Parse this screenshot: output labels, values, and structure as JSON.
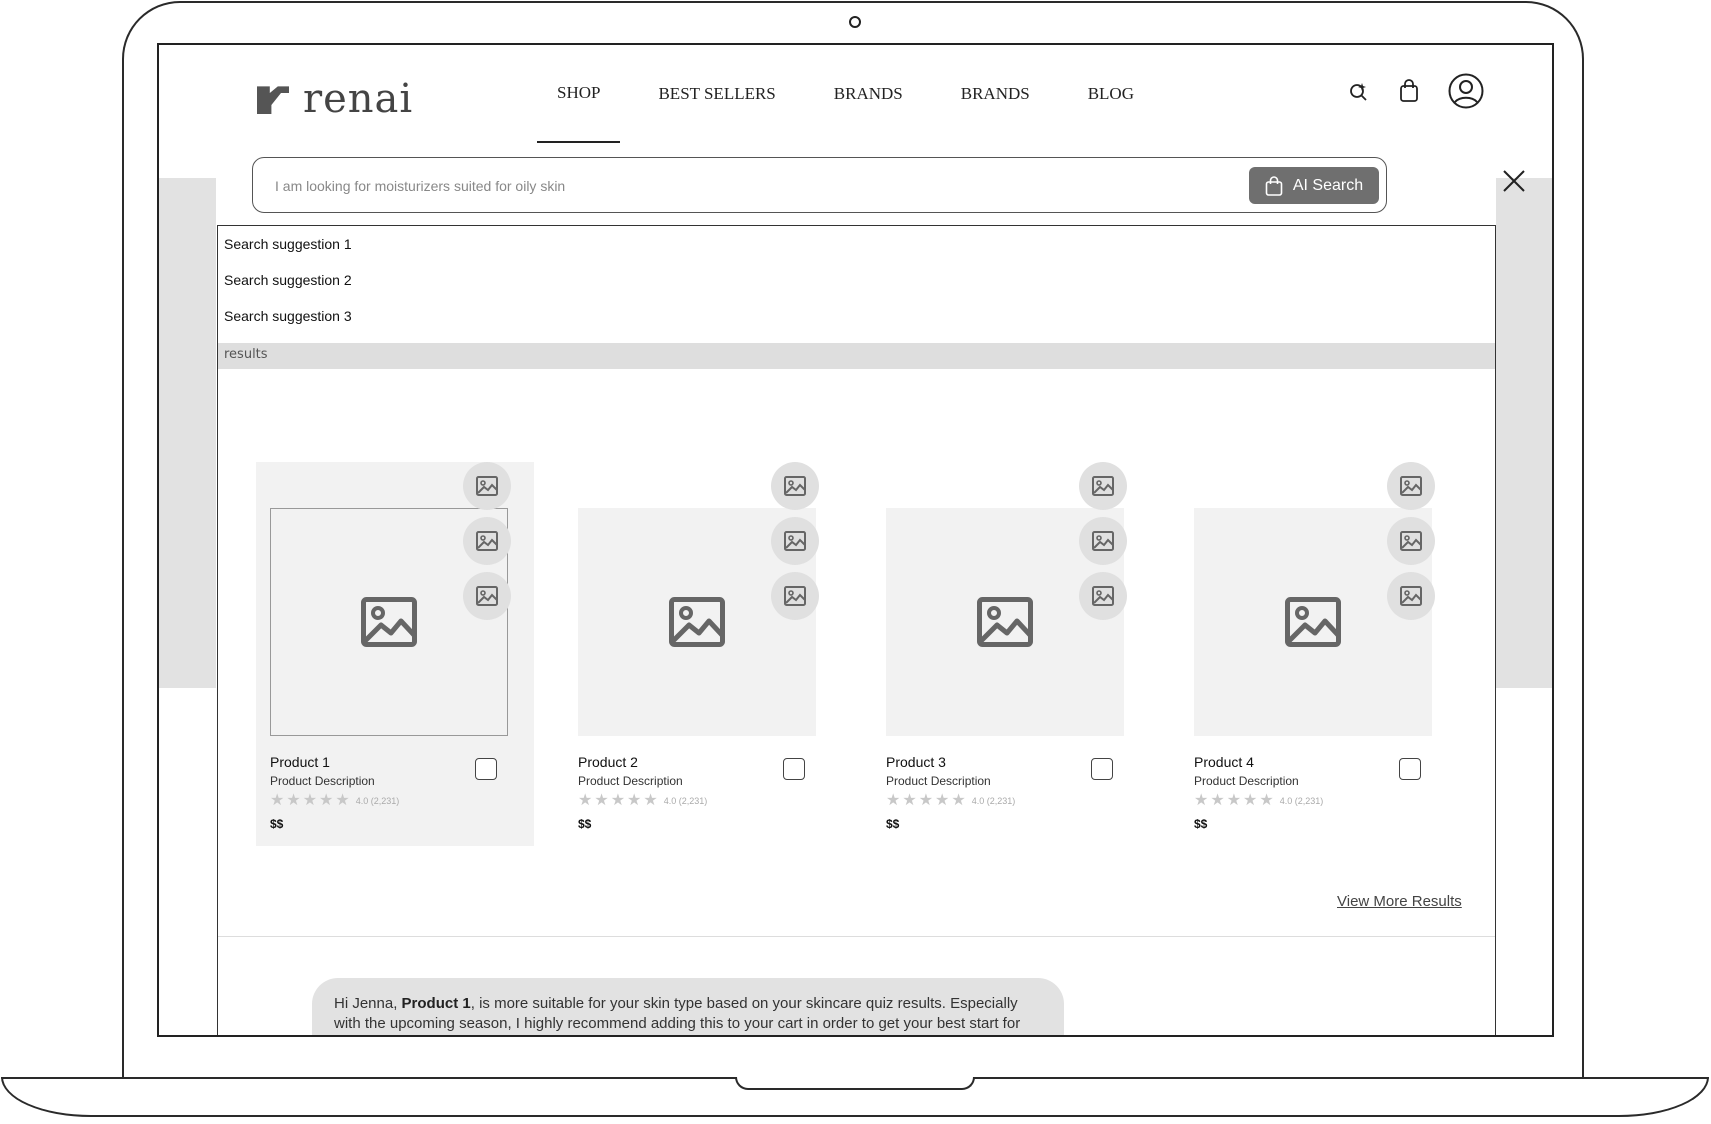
{
  "header": {
    "logo_text": "renai",
    "nav": [
      "SHOP",
      "BEST SELLERS",
      "BRANDS",
      "BRANDS",
      "BLOG"
    ],
    "active_nav": "SHOP",
    "icons": [
      "ai-search-icon",
      "bag-icon",
      "user-icon"
    ]
  },
  "search": {
    "placeholder": "I am looking for moisturizers suited for oily skin",
    "ai_button_label": "AI Search",
    "close_icon": "close-icon"
  },
  "suggestions": [
    "Search suggestion 1",
    "Search suggestion 2",
    "Search suggestion 3"
  ],
  "results_label": "results",
  "products": [
    {
      "name": "Product 1",
      "description": "Product Description",
      "rating": "4.0 (2,231)",
      "stars": 5,
      "price": "$$",
      "highlighted": true
    },
    {
      "name": "Product 2",
      "description": "Product Description",
      "rating": "4.0 (2,231)",
      "stars": 5,
      "price": "$$",
      "highlighted": false
    },
    {
      "name": "Product 3",
      "description": "Product Description",
      "rating": "4.0 (2,231)",
      "stars": 5,
      "price": "$$",
      "highlighted": false
    },
    {
      "name": "Product 4",
      "description": "Product Description",
      "rating": "4.0 (2,231)",
      "stars": 5,
      "price": "$$",
      "highlighted": false
    }
  ],
  "view_more_label": "View More Results",
  "chat": {
    "greeting": "Hi Jenna, ",
    "product": "Product 1",
    "message": ", is more suitable for your skin type based on your skincare quiz results. Especially with the upcoming season, I highly recommend adding this to your cart in order to get your best start for your skin care routine."
  },
  "colors": {
    "ai_button": "#6f6f6f",
    "panel_bg": "#f2f2f2",
    "results_bar": "#dedede",
    "side_bg": "#e2e2e2"
  }
}
